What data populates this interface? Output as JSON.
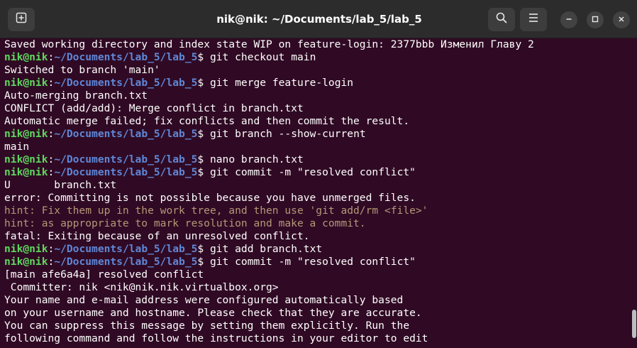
{
  "window": {
    "title": "nik@nik: ~/Documents/lab_5/lab_5"
  },
  "icons": {
    "new_tab": "new-tab-icon",
    "search": "search-icon",
    "menu": "hamburger-menu-icon",
    "minimize": "minimize-icon",
    "maximize": "maximize-icon",
    "close": "close-icon"
  },
  "colors": {
    "background": "#300a24",
    "prompt_user": "#5fd75f",
    "prompt_path": "#5f87d7",
    "hint_text": "#b59777",
    "text": "#ffffff"
  },
  "terminal": {
    "prompt": {
      "user": "nik@nik",
      "path": "~/Documents/lab_5/lab_5",
      "suffix": "$ "
    },
    "lines": [
      {
        "type": "output",
        "text": "Saved working directory and index state WIP on feature-login: 2377bbb Изменил Главу 2"
      },
      {
        "type": "prompt",
        "cmd": "git checkout main"
      },
      {
        "type": "output",
        "text": "Switched to branch 'main'"
      },
      {
        "type": "prompt",
        "cmd": "git merge feature-login"
      },
      {
        "type": "output",
        "text": "Auto-merging branch.txt"
      },
      {
        "type": "output",
        "text": "CONFLICT (add/add): Merge conflict in branch.txt"
      },
      {
        "type": "output",
        "text": "Automatic merge failed; fix conflicts and then commit the result."
      },
      {
        "type": "prompt",
        "cmd": "git branch --show-current"
      },
      {
        "type": "output",
        "text": "main"
      },
      {
        "type": "prompt",
        "cmd": "nano branch.txt"
      },
      {
        "type": "prompt",
        "cmd": "git commit -m \"resolved conflict\""
      },
      {
        "type": "output",
        "text": "U       branch.txt"
      },
      {
        "type": "output",
        "text": "error: Committing is not possible because you have unmerged files."
      },
      {
        "type": "hint",
        "text": "hint: Fix them up in the work tree, and then use 'git add/rm <file>'"
      },
      {
        "type": "hint",
        "text": "hint: as appropriate to mark resolution and make a commit."
      },
      {
        "type": "output",
        "text": "fatal: Exiting because of an unresolved conflict."
      },
      {
        "type": "prompt",
        "cmd": "git add branch.txt"
      },
      {
        "type": "prompt",
        "cmd": "git commit -m \"resolved conflict\""
      },
      {
        "type": "output",
        "text": "[main afe6a4a] resolved conflict"
      },
      {
        "type": "output",
        "text": " Committer: nik <nik@nik.nik.virtualbox.org>"
      },
      {
        "type": "output",
        "text": "Your name and e-mail address were configured automatically based"
      },
      {
        "type": "output",
        "text": "on your username and hostname. Please check that they are accurate."
      },
      {
        "type": "output",
        "text": "You can suppress this message by setting them explicitly. Run the"
      },
      {
        "type": "output",
        "text": "following command and follow the instructions in your editor to edit"
      }
    ]
  }
}
